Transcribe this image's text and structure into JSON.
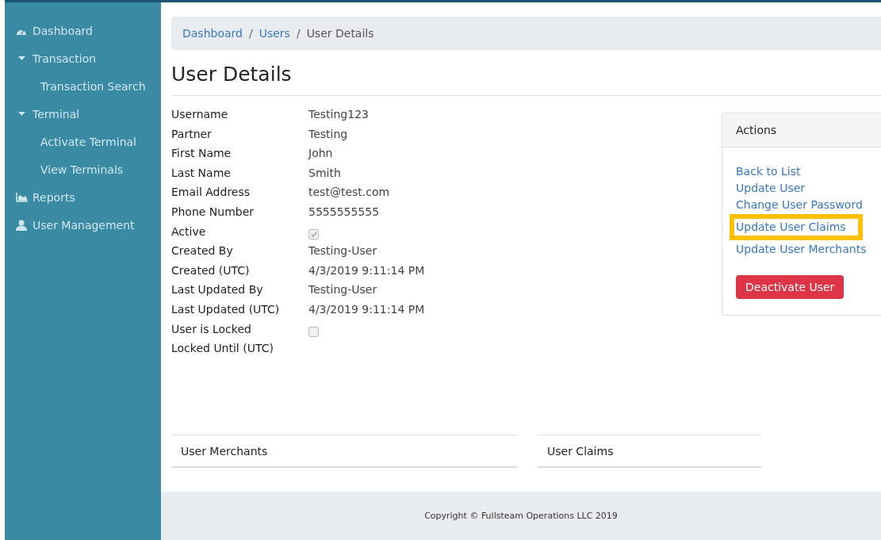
{
  "sidebar": {
    "items": [
      {
        "label": "Dashboard",
        "kind": "dashboard"
      },
      {
        "label": "Transaction",
        "kind": "group",
        "expanded": true,
        "children": [
          {
            "label": "Transaction Search"
          }
        ]
      },
      {
        "label": "Terminal",
        "kind": "group",
        "expanded": true,
        "children": [
          {
            "label": "Activate Terminal"
          },
          {
            "label": "View Terminals"
          }
        ]
      },
      {
        "label": "Reports",
        "kind": "reports"
      },
      {
        "label": "User Management",
        "kind": "users"
      }
    ]
  },
  "breadcrumb": [
    {
      "label": "Dashboard",
      "kind": "link"
    },
    {
      "label": "/",
      "kind": "separator"
    },
    {
      "label": "Users",
      "kind": "link"
    },
    {
      "label": "/",
      "kind": "separator"
    },
    {
      "label": "User Details",
      "kind": "current"
    }
  ],
  "page_title": "User Details",
  "details": [
    {
      "label": "Username",
      "kind": "text",
      "value": "Testing123"
    },
    {
      "label": "Partner",
      "kind": "text",
      "value": "Testing"
    },
    {
      "label": "First Name",
      "kind": "text",
      "value": "John"
    },
    {
      "label": "Last Name",
      "kind": "text",
      "value": "Smith"
    },
    {
      "label": "Email Address",
      "kind": "text",
      "value": "test@test.com"
    },
    {
      "label": "Phone Number",
      "kind": "text",
      "value": "5555555555"
    },
    {
      "label": "Active",
      "kind": "checkbox",
      "checked": true
    },
    {
      "label": "Created By",
      "kind": "text",
      "value": "Testing-User"
    },
    {
      "label": "Created (UTC)",
      "kind": "text",
      "value": "4/3/2019 9:11:14 PM"
    },
    {
      "label": "Last Updated By",
      "kind": "text",
      "value": "Testing-User"
    },
    {
      "label": "Last Updated (UTC)",
      "kind": "text",
      "value": "4/3/2019 9:11:14 PM"
    },
    {
      "label": "User is Locked",
      "kind": "checkbox",
      "checked": false
    },
    {
      "label": "Locked Until (UTC)",
      "kind": "text"
    }
  ],
  "actions": {
    "title": "Actions",
    "links": [
      {
        "label": "Back to List",
        "highlighted": false
      },
      {
        "label": "Update User",
        "highlighted": false
      },
      {
        "label": "Change User Password",
        "highlighted": false
      },
      {
        "label": "Update User Claims",
        "highlighted": true
      },
      {
        "label": "Update User Merchants",
        "highlighted": false
      }
    ],
    "button": "Deactivate User"
  },
  "panels": [
    {
      "title": "User Merchants"
    },
    {
      "title": "User Claims"
    }
  ],
  "footer": "Copyright © Fullsteam Operations LLC 2019"
}
